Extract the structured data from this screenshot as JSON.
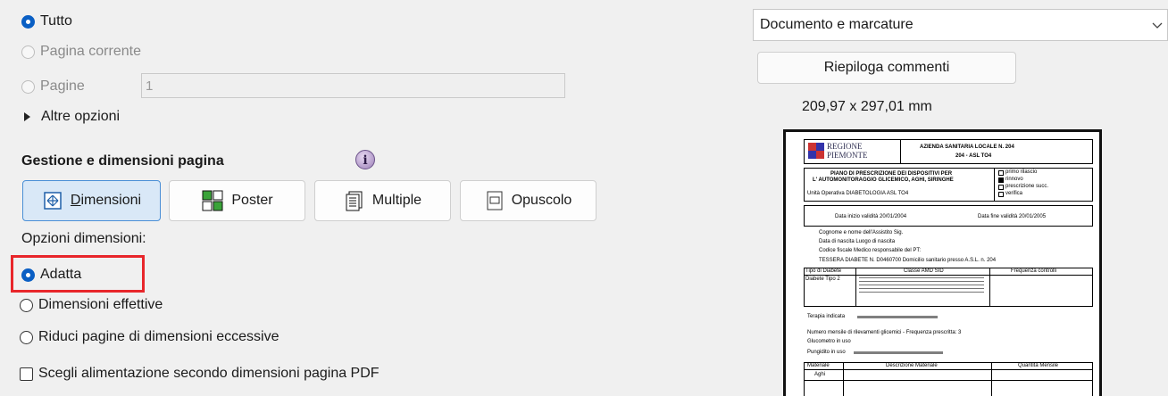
{
  "page_range": {
    "all": "Tutto",
    "current_page": "Pagina corrente",
    "pages": "Pagine",
    "pages_value": "1",
    "more_options": "Altre opzioni"
  },
  "page_handling": {
    "title": "Gestione e dimensioni pagina",
    "buttons": {
      "size": "Dimensioni",
      "size_accel": "D",
      "size_rest": "imensioni",
      "poster": "Poster",
      "multiple": "Multiple",
      "booklet": "Opuscolo"
    },
    "size_options_label": "Opzioni dimensioni:",
    "fit": "Adatta",
    "actual_size": "Dimensioni effettive",
    "shrink": "Riduci pagine di dimensioni eccessive",
    "choose_source": "Scegli alimentazione secondo dimensioni pagina PDF"
  },
  "comments": {
    "select_value": "Documento e marcature",
    "summarize": "Riepiloga commenti"
  },
  "preview": {
    "page_size": "209,97 x 297,01 mm",
    "doc": {
      "region_line1": "REGIONE",
      "region_line2": "PIEMONTE",
      "asl_line1": "AZIENDA SANITARIA LOCALE N.   204",
      "asl_line2": "204 - ASL TO4",
      "plan_line1": "PIANO DI PRESCRIZIONE DEI DISPOSITIVI PER",
      "plan_line2": "L' AUTOMONITORAGGIO GLICEMICO, AGHI, SIRINGHE",
      "unit": "Unità Operativa   DIABETOLOGIA ASL TO4",
      "opt1": "primo rilascio",
      "opt2": "rinnovo",
      "opt3": "prescrizione succ.",
      "opt4": "verifica",
      "start_date": "Data inizio validità  20/01/2004",
      "end_date": "Data fine validità  20/01/2005",
      "patient": "Cognome e nome dell'Assistito  Sig.",
      "birth": "Data di nascita          Luogo di nascita",
      "fiscal": "Codice fiscale          Medico responsabile del PT:",
      "card": "TESSERA DIABETE N.  D0460700     Domicilio sanitario presso A.S.L. n.  204",
      "col1": "Tipo di Diabete",
      "col2": "Classe AMD SID",
      "col3": "Frequenza controlli",
      "row1": "Diabete Tipo 2",
      "therapy": "Terapia indicata",
      "checks": "Numero  mensile  di rilevamenti glicemici - Frequenza prescritta: 3",
      "meter": "Glucometro in uso",
      "lancet": "Pungidito in uso",
      "mat_col1": "Materiale",
      "mat_col2": "Descrizione Materiale",
      "mat_col3": "Quantità Mensile",
      "mat_row": "Aghi"
    }
  }
}
